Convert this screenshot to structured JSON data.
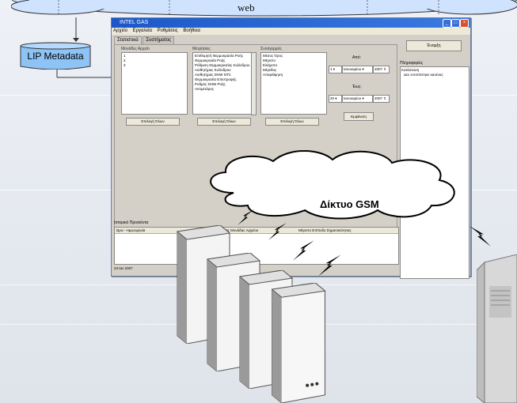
{
  "diagram": {
    "web_label": "web",
    "lip_metadata_label": "LIP Metadata",
    "gsm_cloud_label": "Δίκτυο GSM"
  },
  "window": {
    "title": "INTEL GAS",
    "menu": [
      "Αρχείο",
      "Εργαλεία",
      "Ρυθμίσεις",
      "Βοήθεια"
    ],
    "tabs": [
      "Στατιστικά",
      "Συστήματος"
    ],
    "groups": {
      "files_title": "Μονάδες Αρχείο",
      "files_items": [
        "1",
        "2",
        "3"
      ],
      "files_select_all": "Επιλογή Όλων",
      "metrics_title": "Μετρήσεις",
      "metrics_items": [
        "Επιθυμητή Θερμοκρασία Ροής",
        "Θερμοκρασία Ροής",
        "Ρύθμιση Θερμοκρασίας Κυλίνδρου",
        "Αισθητήρας Κυλίνδρου",
        "Αισθητήρας DHW NTC",
        "Θερμοκρασία Επιστροφής",
        "Ρυθμός DHW Ροής",
        "Αντιμετάρος"
      ],
      "metrics_select_all": "Επιλογή Όλων",
      "groups_title": "Συναγερμός",
      "groups_items": [
        "Μέσος Όρος",
        "Μέγιστο",
        "Ελάχιστο",
        "Μέγεθος",
        "Απαριθμηση"
      ],
      "groups_select_all": "Επιλογή Όλων"
    },
    "date_from": {
      "label": "Από:",
      "day": "1",
      "month": "Ιανουαρίου",
      "year": "2007"
    },
    "date_to": {
      "label": "Έως:",
      "day": "20",
      "month": "Ιανουαρίου",
      "year": "2007"
    },
    "show_button": "Εμφάνιση",
    "run_button": "Έναρξη",
    "info": {
      "title": "Πληροφορίες",
      "lines": [
        "Κατάσταση",
        "Δεν εντοπίστηκε κανένας"
      ]
    },
    "history": {
      "title": "Ιστορικό Προσιόντα",
      "columns": [
        "Ώρα - Ημερομηνία",
        "Κωδικός Μονάδας Αρχείου",
        "Μέγιστο Επίπεδο Σημαντικότητας"
      ]
    },
    "status_text": "23 Ιαν 2007"
  }
}
